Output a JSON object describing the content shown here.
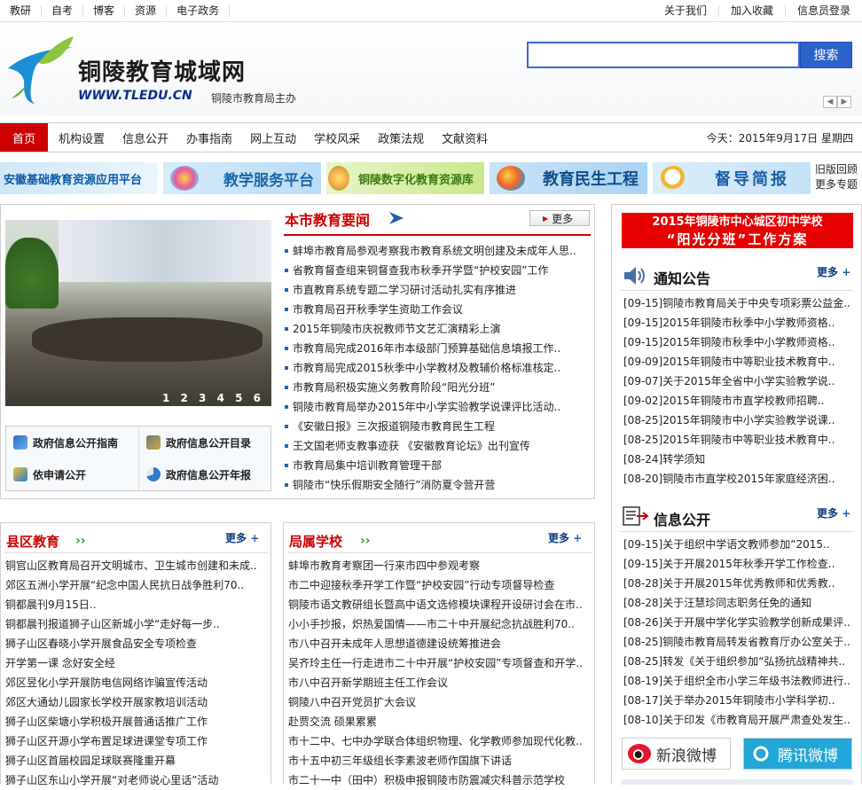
{
  "topbar": {
    "left_links": [
      "教研",
      "自考",
      "博客",
      "资源",
      "电子政务"
    ],
    "right_links": [
      "关于我们",
      "加入收藏",
      "信息员登录"
    ]
  },
  "header": {
    "title": "铜陵教育城域网",
    "url": "WWW.TLEDU.CN",
    "subtitle": "铜陵市教育局主办",
    "search_value": "",
    "search_button": "搜索"
  },
  "nav": {
    "items": [
      "首页",
      "机构设置",
      "信息公开",
      "办事指南",
      "网上互动",
      "学校风采",
      "政策法规",
      "文献资料"
    ],
    "date": "今天：2015年9月17日  星期四"
  },
  "banners": {
    "items": [
      "安徽基础教育资源应用平台",
      "教学服务平台",
      "铜陵数字化教育资源库",
      "教育民生工程",
      "督导简报"
    ],
    "side_links": [
      "旧版回顾",
      "更多专题"
    ]
  },
  "slideshow": {
    "pages": "1 2 3 4 5 6"
  },
  "gov_links": [
    "政府信息公开指南",
    "政府信息公开目录",
    "依申请公开",
    "政府信息公开年报"
  ],
  "city_news": {
    "title": "本市教育要闻",
    "more": "更多",
    "items": [
      "蚌埠市教育局参观考察我市教育系统文明创建及未成年人思..",
      "省教育督查组来铜督查我市秋季开学暨“护校安园”工作",
      "市直教育系统专题二学习研讨活动扎实有序推进",
      "市教育局召开秋季学生资助工作会议",
      "2015年铜陵市庆祝教师节文艺汇演精彩上演",
      "市教育局完成2016年市本级部门预算基础信息填报工作..",
      "市教育局完成2015秋季中小学教材及教辅价格标准核定..",
      "市教育局积极实施义务教育阶段“阳光分班”",
      "铜陵市教育局举办2015年中小学实验教学说课评比活动..",
      "《安徽日报》三次报道铜陵市教育民生工程",
      "王文国老师支教事迹获 《安徽教育论坛》出刊宣传",
      "市教育局集中培训教育管理干部",
      "铜陵市“快乐假期安全随行”消防夏令营开营"
    ]
  },
  "county": {
    "title": "县区教育",
    "more": "更多",
    "items": [
      "铜官山区教育局召开文明城市、卫生城市创建和未成..",
      "郊区五洲小学开展“纪念中国人民抗日战争胜利70..",
      "铜都晨刊9月15日..",
      "铜都晨刊报道狮子山区新城小学“走好每一步..",
      "狮子山区春晓小学开展食品安全专项检查",
      "开学第一课  念好安全经",
      "郊区昱化小学开展防电信网络诈骗宣传活动",
      "郊区大通幼儿园家长学校开展家教培训活动",
      "狮子山区柴塘小学积极开展普通话推广工作",
      "狮子山区开源小学布置足球进课堂专项工作",
      "狮子山区首届校园足球联赛隆重开幕",
      "狮子山区东山小学开展“对老师说心里话”活动"
    ]
  },
  "schools": {
    "title": "局属学校",
    "more": "更多",
    "items": [
      "蚌埠市教育考察团一行来市四中参观考察",
      "市二中迎接秋季开学工作暨“护校安园”行动专项督导检查",
      "铜陵市语文教研组长暨高中语文选修模块课程开设研讨会在市..",
      "小小手抄报，炽热爱国情——市二十中开展纪念抗战胜利70..",
      "市八中召开未成年人思想道德建设统筹推进会",
      "吴齐玲主任一行走进市二十中开展“护校安园”专项督查和开学..",
      "市八中召开新学期班主任工作会议",
      "铜陵八中召开党员扩大会议",
      "赴贾交流  硕果累累",
      "市十二中、七中办学联合体组织物理、化学教师参加现代化教..",
      "市十五中初三年级组长李素波老师作国旗下讲话",
      "市二十一中（田中）积极申报铜陵市防震减灾科普示范学校"
    ]
  },
  "promo": {
    "line1": "2015年铜陵市中心城区初中学校",
    "line2": "“阳光分班”工作方案"
  },
  "notices": {
    "title": "通知公告",
    "more": "更多",
    "items": [
      "[09-15]铜陵市教育局关于中央专项彩票公益金..",
      "[09-15]2015年铜陵市秋季中小学教师资格..",
      "[09-15]2015年铜陵市秋季中小学教师资格..",
      "[09-09]2015年铜陵市中等职业技术教育中..",
      "[09-07]关于2015年全省中小学实验教学说..",
      "[09-02]2015年铜陵市市直学校教师招聘..",
      "[08-25]2015年铜陵市中小学实验教学说课..",
      "[08-25]2015年铜陵市中等职业技术教育中..",
      "[08-24]转学须知",
      "[08-20]铜陵市市直学校2015年家庭经济困.."
    ]
  },
  "info": {
    "title": "信息公开",
    "more": "更多",
    "items": [
      "[09-15]关于组织中学语文教师参加“2015..",
      "[09-15]关于开展2015年秋季开学工作检查..",
      "[08-28]关于开展2015年优秀教师和优秀教..",
      "[08-28]关于汪慧珍同志职务任免的通知",
      "[08-26]关于开展中学化学实验教学创新成果评..",
      "[08-25]铜陵市教育局转发省教育厅办公室关于..",
      "[08-25]转发《关于组织参加“弘扬抗战精神共..",
      "[08-19]关于组织全市小学三年级书法教师进行..",
      "[08-17]关于举办2015年铜陵市小学科学初..",
      "[08-10]关于印发《市教育局开展严肃查处发生.."
    ]
  },
  "weibo": {
    "sina": "新浪微博",
    "qq": "腾讯微博"
  },
  "colors": {
    "accent_red": "#cc0000",
    "nav_active": "#cc0000",
    "search_blue": "#2d63c8",
    "link_blue": "#0b3a7a"
  }
}
